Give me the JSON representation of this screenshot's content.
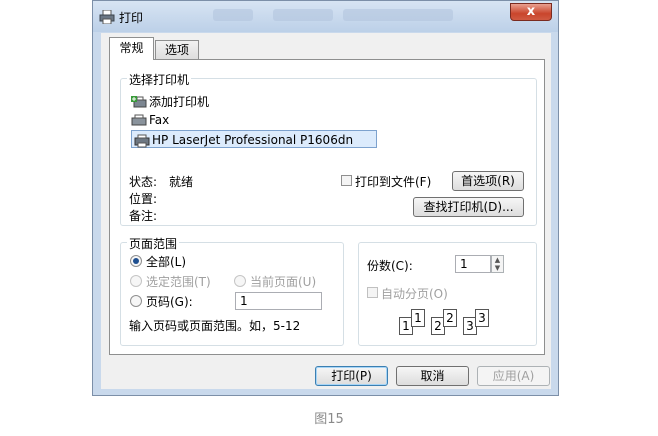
{
  "window": {
    "title": "打印",
    "close_symbol": "x"
  },
  "tabs": [
    {
      "label": "常规",
      "active": true
    },
    {
      "label": "选项",
      "active": false
    }
  ],
  "select_printer": {
    "group_title": "选择打印机",
    "printers": [
      {
        "name": "添加打印机",
        "icon": "add-printer-icon"
      },
      {
        "name": "Fax",
        "icon": "fax-icon"
      },
      {
        "name": "HP LaserJet Professional P1606dn",
        "icon": "printer-icon",
        "selected": true
      }
    ],
    "status_label": "状态:",
    "status_value": "就绪",
    "location_label": "位置:",
    "comment_label": "备注:",
    "print_to_file_label": "打印到文件(F)",
    "print_to_file_checked": false,
    "preferences_button": "首选项(R)",
    "find_printer_button": "查找打印机(D)..."
  },
  "page_range": {
    "group_title": "页面范围",
    "options": {
      "all": "全部(L)",
      "selection": "选定范围(T)",
      "current": "当前页面(U)",
      "pages": "页码(G):"
    },
    "selected": "all",
    "pages_value": "1",
    "hint": "输入页码或页面范围。如，5-12"
  },
  "copies": {
    "label": "份数(C):",
    "value": "1",
    "collate_label": "自动分页(O)",
    "collate_checked": false,
    "collate_pages": [
      "1",
      "1",
      "2",
      "2",
      "3",
      "3"
    ]
  },
  "footer": {
    "print": "打印(P)",
    "cancel": "取消",
    "apply": "应用(A)"
  },
  "caption": "图15",
  "colors": {
    "frame": "#c9d9ec",
    "selected_row": "#dcebfc",
    "close": "#c9452c"
  }
}
